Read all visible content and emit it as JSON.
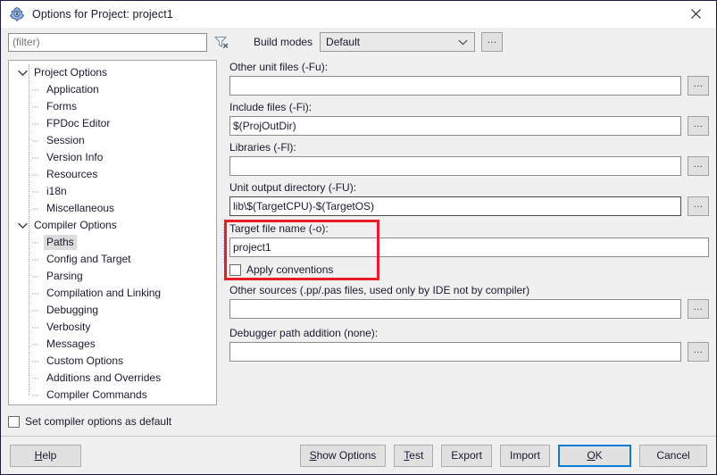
{
  "window": {
    "title": "Options for Project: project1",
    "icon": "lazarus-logo-icon",
    "close_label": "✕",
    "accent_focus_color": "#0a7cd6",
    "highlight_color": "#ec1c24",
    "background_color": "#f0f0f0"
  },
  "toolbar": {
    "filter_value": "",
    "filter_placeholder": "(filter)",
    "clear_filter_icon": "filter-clear-icon",
    "build_modes_label": "Build modes",
    "build_mode_selected": "Default",
    "build_mode_options": [
      "Default"
    ],
    "build_modes_ellipsis": "..."
  },
  "tree": {
    "items": [
      {
        "label": "Project Options",
        "level": 0,
        "expanded": true,
        "selected": false
      },
      {
        "label": "Application",
        "level": 1,
        "expanded": null,
        "selected": false
      },
      {
        "label": "Forms",
        "level": 1,
        "expanded": null,
        "selected": false
      },
      {
        "label": "FPDoc Editor",
        "level": 1,
        "expanded": null,
        "selected": false
      },
      {
        "label": "Session",
        "level": 1,
        "expanded": null,
        "selected": false
      },
      {
        "label": "Version Info",
        "level": 1,
        "expanded": null,
        "selected": false
      },
      {
        "label": "Resources",
        "level": 1,
        "expanded": null,
        "selected": false
      },
      {
        "label": "i18n",
        "level": 1,
        "expanded": null,
        "selected": false
      },
      {
        "label": "Miscellaneous",
        "level": 1,
        "expanded": null,
        "selected": false
      },
      {
        "label": "Compiler Options",
        "level": 0,
        "expanded": true,
        "selected": false
      },
      {
        "label": "Paths",
        "level": 1,
        "expanded": null,
        "selected": true
      },
      {
        "label": "Config and Target",
        "level": 1,
        "expanded": null,
        "selected": false
      },
      {
        "label": "Parsing",
        "level": 1,
        "expanded": null,
        "selected": false
      },
      {
        "label": "Compilation and Linking",
        "level": 1,
        "expanded": null,
        "selected": false
      },
      {
        "label": "Debugging",
        "level": 1,
        "expanded": null,
        "selected": false
      },
      {
        "label": "Verbosity",
        "level": 1,
        "expanded": null,
        "selected": false
      },
      {
        "label": "Messages",
        "level": 1,
        "expanded": null,
        "selected": false
      },
      {
        "label": "Custom Options",
        "level": 1,
        "expanded": null,
        "selected": false
      },
      {
        "label": "Additions and Overrides",
        "level": 1,
        "expanded": null,
        "selected": false
      },
      {
        "label": "Compiler Commands",
        "level": 1,
        "expanded": null,
        "selected": false
      }
    ]
  },
  "set_default": {
    "label": "Set compiler options as default",
    "checked": false
  },
  "paths_page": {
    "fields": [
      {
        "label": "Other unit files (-Fu):",
        "value": "",
        "has_browse": true,
        "browse_label": "...",
        "focused": false,
        "name": "other-unit-files"
      },
      {
        "label": "Include files (-Fi):",
        "value": "$(ProjOutDir)",
        "has_browse": true,
        "browse_label": "...",
        "focused": false,
        "name": "include-files"
      },
      {
        "label": "Libraries (-Fl):",
        "value": "",
        "has_browse": true,
        "browse_label": "...",
        "focused": false,
        "name": "libraries"
      },
      {
        "label": "Unit output directory (-FU):",
        "value": "lib\\$(TargetCPU)-$(TargetOS)",
        "has_browse": true,
        "browse_label": "...",
        "focused": true,
        "name": "unit-output-directory"
      },
      {
        "label": "Target file name (-o):",
        "value": "project1",
        "has_browse": false,
        "browse_label": "",
        "focused": false,
        "name": "target-file-name"
      }
    ],
    "apply_conventions": {
      "label": "Apply conventions",
      "checked": false
    },
    "other_sources": {
      "label": "Other sources (.pp/.pas files, used only by IDE not by compiler)",
      "value": "",
      "browse_label": "..."
    },
    "debugger_path": {
      "label": "Debugger path addition (none):",
      "value": "",
      "browse_label": "..."
    }
  },
  "footer": {
    "help": {
      "label": "Help",
      "accel": "H"
    },
    "show_options": {
      "label": "Show Options",
      "accel": "S"
    },
    "test": {
      "label": "Test",
      "accel": "T"
    },
    "export": {
      "label": "Export",
      "accel": ""
    },
    "import": {
      "label": "Import",
      "accel": ""
    },
    "ok": {
      "label": "OK",
      "accel": "O",
      "is_default": true
    },
    "cancel": {
      "label": "Cancel",
      "accel": ""
    }
  }
}
